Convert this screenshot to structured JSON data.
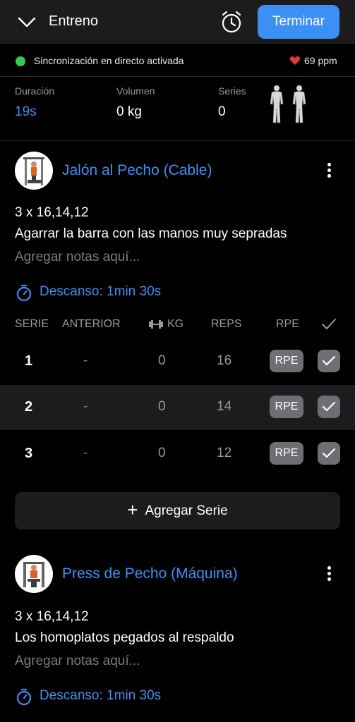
{
  "header": {
    "title": "Entreno",
    "finish_label": "Terminar",
    "collapse_icon": "chevron-down-icon",
    "timer_icon": "alarm-clock-icon"
  },
  "sync": {
    "text": "Sincronización en directo activada",
    "status_color": "#34c759",
    "heart_rate": "69 ppm"
  },
  "stats": {
    "duration_label": "Duración",
    "duration_value": "19s",
    "volume_label": "Volumen",
    "volume_value": "0 kg",
    "series_label": "Series",
    "series_value": "0"
  },
  "exercises": [
    {
      "name": "Jalón al Pecho (Cable)",
      "scheme": "3 x 16,14,12",
      "note": "Agarrar la barra con las manos muy sepradas",
      "notes_placeholder": "Agregar notas aquí...",
      "rest": "Descanso: 1min 30s",
      "table_headers": {
        "set": "SERIE",
        "previous": "ANTERIOR",
        "kg": "KG",
        "reps": "REPS",
        "rpe": "RPE"
      },
      "sets": [
        {
          "set": "1",
          "previous": "-",
          "kg": "0",
          "reps": "16",
          "rpe": "RPE"
        },
        {
          "set": "2",
          "previous": "-",
          "kg": "0",
          "reps": "14",
          "rpe": "RPE"
        },
        {
          "set": "3",
          "previous": "-",
          "kg": "0",
          "reps": "12",
          "rpe": "RPE"
        }
      ],
      "add_series_label": "Agregar Serie"
    },
    {
      "name": "Press de Pecho (Máquina)",
      "scheme": "3 x 16,14,12",
      "note": "Los homoplatos pegados al respaldo",
      "notes_placeholder": "Agregar notas aquí...",
      "rest": "Descanso: 1min 30s"
    }
  ],
  "colors": {
    "accent": "#3b8ff5",
    "background": "#000000",
    "surface": "#1c1c1e",
    "button_gray": "#6e6e73"
  }
}
